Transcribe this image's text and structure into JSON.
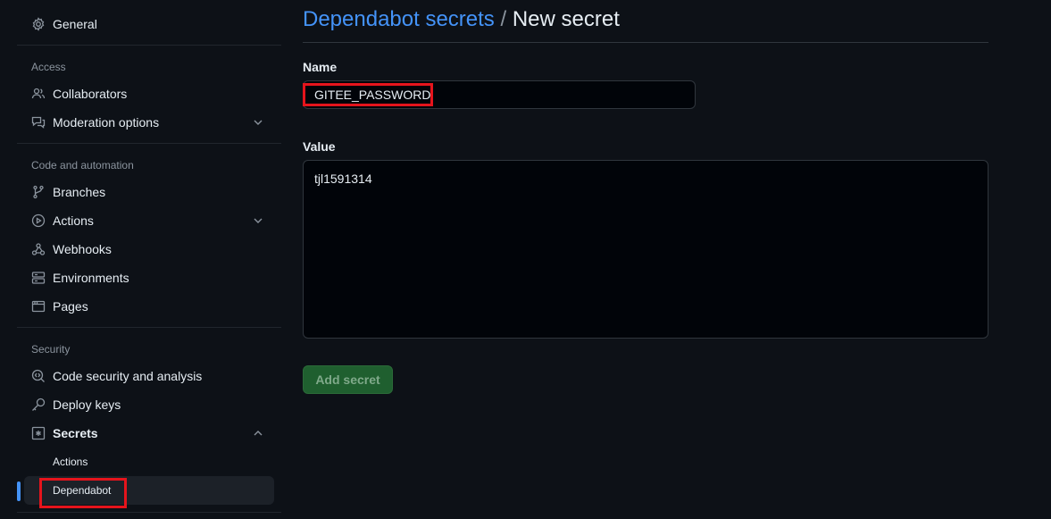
{
  "sidebar": {
    "general": "General",
    "sections": {
      "access": "Access",
      "code": "Code and automation",
      "security": "Security"
    },
    "items": {
      "collaborators": "Collaborators",
      "moderation": "Moderation options",
      "branches": "Branches",
      "actions": "Actions",
      "webhooks": "Webhooks",
      "environments": "Environments",
      "pages": "Pages",
      "code_security": "Code security and analysis",
      "deploy_keys": "Deploy keys",
      "secrets": "Secrets",
      "secrets_actions": "Actions",
      "secrets_dependabot": "Dependabot"
    }
  },
  "main": {
    "breadcrumb_link": "Dependabot secrets",
    "breadcrumb_sep": "/",
    "breadcrumb_current": "New secret",
    "name_label": "Name",
    "name_value": "GITEE_PASSWORD",
    "value_label": "Value",
    "value_value": "tjl1591314",
    "add_button": "Add secret"
  },
  "colors": {
    "accent": "#4493f8",
    "highlight": "#e5141c",
    "button": "#1f5f2f"
  }
}
